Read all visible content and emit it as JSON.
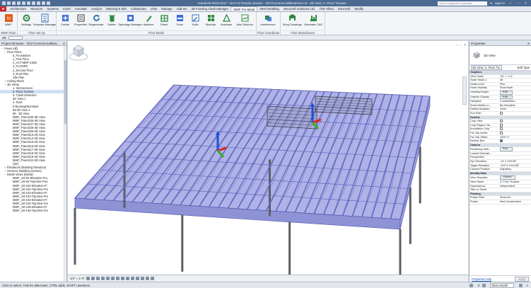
{
  "window": {
    "title": "Autodesk Revit 2017 - Not For Resale Version - 2017CommercialBusiness.rvt - 3D View: 2- Floor Trusses",
    "search_placeholder": "Type a keyword or phrase",
    "sign_in": "Sign In"
  },
  "tabs": [
    "R",
    "Architecture",
    "Structure",
    "Systems",
    "Insert",
    "Annotate",
    "Analyze",
    "Massing & Site",
    "Collaborate",
    "View",
    "Manage",
    "Add-Ins",
    "3D Framing Clash Manager",
    "MWF Pro Metal",
    "Steel Detailing",
    "StrucSoft Solutions Ltd.",
    "ITW Hilma",
    "StrucSoft",
    "Modify"
  ],
  "active_tab_index": 13,
  "ribbon": {
    "groups": [
      {
        "label": "MWF Pane",
        "buttons": [
          {
            "label": "MWF",
            "icon": "mwf-logo-icon"
          }
        ]
      },
      {
        "label": "Floor Set Up",
        "buttons": [
          {
            "label": "Settings",
            "icon": "settings-icon"
          },
          {
            "label": "Template Manager",
            "icon": "template-manager-icon"
          }
        ]
      },
      {
        "label": "Floor Model",
        "buttons": [
          {
            "label": "Create",
            "icon": "create-icon"
          },
          {
            "label": "Properties",
            "icon": "properties-icon"
          },
          {
            "label": "Regenerate",
            "icon": "regenerate-icon"
          },
          {
            "label": "Delete",
            "icon": "delete-icon"
          },
          {
            "label": "Openings Manager",
            "icon": "openings-manager-icon"
          },
          {
            "label": "Markers",
            "icon": "markers-icon"
          },
          {
            "label": "Panel",
            "icon": "panel-icon"
          },
          {
            "label": "Tools",
            "icon": "tools-icon"
          },
          {
            "label": "Edits",
            "icon": "edits-icon"
          },
          {
            "label": "Modular",
            "icon": "modular-icon"
          },
          {
            "label": "Annotate",
            "icon": "annotate-icon"
          },
          {
            "label": "Joist Selector",
            "icon": "joist-selector-icon"
          }
        ]
      },
      {
        "label": "Floor Coordinate",
        "buttons": [
          {
            "label": "Interference",
            "icon": "interference-icon"
          }
        ]
      },
      {
        "label": "Floor Manufacture",
        "buttons": [
          {
            "label": "Shop Drawings",
            "icon": "shop-drawings-icon"
          },
          {
            "label": "Generate CNC",
            "icon": "generate-cnc-icon"
          }
        ]
      }
    ]
  },
  "options_bar": {
    "label": "3D",
    "icons": [
      "options-icon"
    ]
  },
  "project_browser": {
    "title": "Project Browser - 2017CommercialBusi...",
    "close": "X",
    "items": [
      {
        "label": "Views (all)",
        "indent": 0,
        "toggle": "−"
      },
      {
        "label": "Floor Plans",
        "indent": 1,
        "toggle": "−"
      },
      {
        "label": "0_Foundation",
        "indent": 3,
        "toggle": ""
      },
      {
        "label": "1_First Floor",
        "indent": 3,
        "toggle": ""
      },
      {
        "label": "2_ACT-MEP Clash",
        "indent": 3,
        "toggle": ""
      },
      {
        "label": "2_FLOORS",
        "indent": 3,
        "toggle": ""
      },
      {
        "label": "2_Second Floor",
        "indent": 3,
        "toggle": ""
      },
      {
        "label": "3_Roof Plan",
        "indent": 3,
        "toggle": ""
      },
      {
        "label": "Site Plan",
        "indent": 3,
        "toggle": ""
      },
      {
        "label": "Ceiling Plans",
        "indent": 1,
        "toggle": "+"
      },
      {
        "label": "3D Views",
        "indent": 1,
        "toggle": "−"
      },
      {
        "label": "1- Intersections",
        "indent": 3,
        "toggle": ""
      },
      {
        "label": "2- Floor Trusses",
        "indent": 3,
        "toggle": "",
        "selected": true
      },
      {
        "label": "3- Clash Detection",
        "indent": 3,
        "toggle": ""
      },
      {
        "label": "3D View 1",
        "indent": 3,
        "toggle": ""
      },
      {
        "label": "4- Roof",
        "indent": 3,
        "toggle": ""
      },
      {
        "label": "5-Bucking/Wombats",
        "indent": 3,
        "toggle": ""
      },
      {
        "label": "99-3D View 1",
        "indent": 3,
        "toggle": ""
      },
      {
        "label": "99 - 3D View",
        "indent": 3,
        "toggle": ""
      },
      {
        "label": "MWF_Panel105-3D View",
        "indent": 3,
        "toggle": ""
      },
      {
        "label": "MWF_Panel106-3D View",
        "indent": 3,
        "toggle": ""
      },
      {
        "label": "MWF_Panel107-3D View",
        "indent": 3,
        "toggle": ""
      },
      {
        "label": "MWF_Panel108-3D View",
        "indent": 3,
        "toggle": ""
      },
      {
        "label": "MWF_Panel109-3D View",
        "indent": 3,
        "toggle": ""
      },
      {
        "label": "MWF_Panel113-3D View",
        "indent": 3,
        "toggle": ""
      },
      {
        "label": "MWF_Panel114-3D View",
        "indent": 3,
        "toggle": ""
      },
      {
        "label": "MWF_Panel115-3D View",
        "indent": 3,
        "toggle": ""
      },
      {
        "label": "MWF_Panel116-3D View",
        "indent": 3,
        "toggle": ""
      },
      {
        "label": "MWF_Panel117-3D View",
        "indent": 3,
        "toggle": ""
      },
      {
        "label": "MWF_Panel118-3D View",
        "indent": 3,
        "toggle": ""
      },
      {
        "label": "MWF_Panel119-3D View",
        "indent": 3,
        "toggle": ""
      },
      {
        "label": "MWF_Panel120-3D View",
        "indent": 3,
        "toggle": ""
      },
      {
        "label": "{3D}",
        "indent": 3,
        "toggle": ""
      },
      {
        "label": "Elevations (Building Elevation)",
        "indent": 1,
        "toggle": "+"
      },
      {
        "label": "Sections (Building Section)",
        "indent": 1,
        "toggle": "+"
      },
      {
        "label": "Detail Views (Detail)",
        "indent": 1,
        "toggle": "−"
      },
      {
        "label": "MWF_Jst-52-Elevation-Fra",
        "indent": 3,
        "toggle": ""
      },
      {
        "label": "MWF_Jst-52-TopView-Fran",
        "indent": 3,
        "toggle": ""
      },
      {
        "label": "MWF_Jst-102-Elevation-Fr",
        "indent": 3,
        "toggle": ""
      },
      {
        "label": "MWF_Jst-102-TopView-Fra",
        "indent": 3,
        "toggle": ""
      },
      {
        "label": "MWF_Jst-103-Elevation-Fr",
        "indent": 3,
        "toggle": ""
      },
      {
        "label": "MWF_Jst-103-TopView-Fra",
        "indent": 3,
        "toggle": ""
      },
      {
        "label": "MWF_Jst-104-Elevation-Fr",
        "indent": 3,
        "toggle": ""
      },
      {
        "label": "MWF_Jst-104-TopView-Fra",
        "indent": 3,
        "toggle": ""
      },
      {
        "label": "MWF_Jst-139-Elevation-Fr",
        "indent": 3,
        "toggle": ""
      },
      {
        "label": "MWF_Jst-139-TopView-Fra",
        "indent": 3,
        "toggle": ""
      }
    ]
  },
  "viewport": {
    "controls": [
      "−",
      "▫",
      "×"
    ]
  },
  "view_control_bar": {
    "scale": "1/4\" = 1'-0\"",
    "icon_count": 14
  },
  "properties": {
    "title": "Properties",
    "close": "X",
    "type_name": "3D View",
    "selector_value": "3D View: 2- Floor Tru",
    "edit_type": "Edit Type",
    "rows": [
      {
        "cat": "Graphics"
      },
      {
        "k": "View Scale",
        "v": "1/4\" = 1'-0\""
      },
      {
        "k": "Scale Value 1:",
        "v": "48"
      },
      {
        "k": "Detail Level",
        "v": "Fine"
      },
      {
        "k": "Parts Visibility",
        "v": "Show Both"
      },
      {
        "k": "Visibility/Graphi...",
        "v": "Edit...",
        "button": true
      },
      {
        "k": "Graphic Display ...",
        "v": "Edit...",
        "button": true
      },
      {
        "k": "Discipline",
        "v": "Coordination"
      },
      {
        "k": "Show Hidden Li...",
        "v": "By Discipline"
      },
      {
        "k": "Default Analysis...",
        "v": "None"
      },
      {
        "k": "Sun Path",
        "v": "",
        "check": false
      },
      {
        "cat": "Extents"
      },
      {
        "k": "Crop View",
        "v": "",
        "check": false
      },
      {
        "k": "Crop Region Vis...",
        "v": "",
        "check": false
      },
      {
        "k": "Annotation Crop",
        "v": "",
        "check": false
      },
      {
        "k": "Far Clip Active",
        "v": "",
        "check": false
      },
      {
        "k": "Far Clip Offset",
        "v": "1000' 0\""
      },
      {
        "k": "Section Box",
        "v": "",
        "check": true
      },
      {
        "cat": "Camera"
      },
      {
        "k": "Rendering Setti...",
        "v": "Edit...",
        "button": true
      },
      {
        "k": "Locked Orientat...",
        "v": ""
      },
      {
        "k": "Perspective",
        "v": ""
      },
      {
        "k": "Eye Elevation",
        "v": "-14' 0 13/128\""
      },
      {
        "k": "Target Elevation",
        "v": "-102' 6 121/128\""
      },
      {
        "k": "Camera Position",
        "v": "Adjusting"
      },
      {
        "cat": "Identity Data"
      },
      {
        "k": "View Template",
        "v": "<None>",
        "button": true
      },
      {
        "k": "View Name",
        "v": "2- Floor Trusses"
      },
      {
        "k": "Dependency",
        "v": "Independent"
      },
      {
        "k": "Title on Sheet",
        "v": ""
      },
      {
        "cat": "Phasing"
      },
      {
        "k": "Phase Filter",
        "v": "Show All"
      },
      {
        "k": "Phase",
        "v": "New Construction"
      }
    ],
    "help_link": "Properties help",
    "apply": "Apply"
  },
  "status": {
    "message": "Click to select, TAB for alternates, CTRL adds, SHIFT unselects.",
    "count": ":0",
    "model": "Main Model",
    "filter": "0"
  },
  "colors": {
    "accent": "#c8252c",
    "truss": "#6b70c8",
    "title_bar": "#4b6a92"
  }
}
